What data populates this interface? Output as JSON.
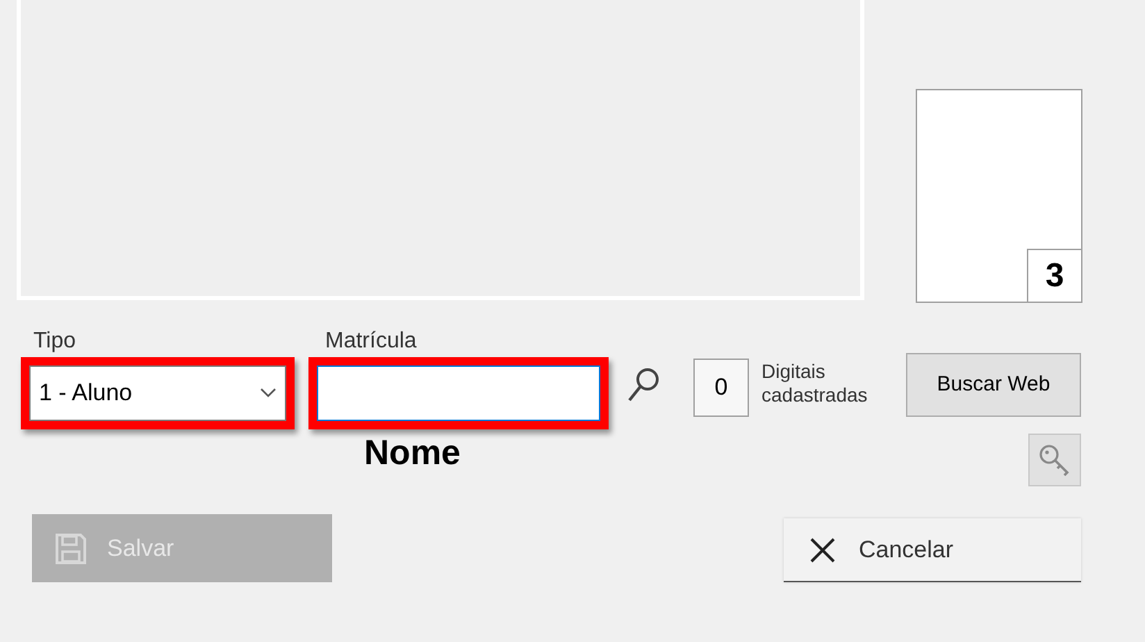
{
  "photo": {
    "badge": "3"
  },
  "tipo": {
    "label": "Tipo",
    "value": "1 - Aluno",
    "highlighted": true
  },
  "matricula": {
    "label": "Matrícula",
    "highlighted": true
  },
  "fingerprints": {
    "count": "0",
    "label": "Digitais cadastradas"
  },
  "buscar_web": {
    "label": "Buscar Web"
  },
  "nome": "Nome",
  "buttons": [
    {
      "kind": "save",
      "label": "Salvar",
      "disabled": true
    },
    {
      "kind": "cancel",
      "label": "Cancelar",
      "disabled": false
    }
  ]
}
